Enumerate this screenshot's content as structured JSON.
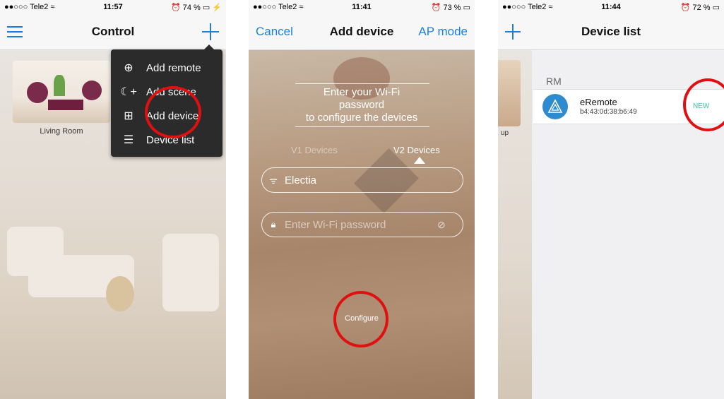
{
  "phone1": {
    "status": {
      "carrier": "●●○○○ Tele2 ≈",
      "time": "11:57",
      "battery": "⏰ 74 % ▭ ⚡"
    },
    "title": "Control",
    "menu_icon": "hamburger-icon",
    "plus_icon": "plus-icon",
    "room_caption": "Living Room",
    "menu": [
      {
        "icon": "remote-add-icon",
        "glyph": "⊕",
        "label": "Add remote"
      },
      {
        "icon": "scene-add-icon",
        "glyph": "☾+",
        "label": "Add scene"
      },
      {
        "icon": "device-add-icon",
        "glyph": "⊞",
        "label": "Add device"
      },
      {
        "icon": "list-icon",
        "glyph": "☰",
        "label": "Device list"
      }
    ]
  },
  "phone2": {
    "status": {
      "carrier": "●●○○○ Tele2 ≈",
      "time": "11:41",
      "battery": "⏰ 73 % ▭"
    },
    "cancel": "Cancel",
    "title": "Add device",
    "ap_mode": "AP mode",
    "prompt": [
      "Enter your Wi-Fi",
      "password",
      "to configure the devices"
    ],
    "tab_v1": "V1 Devices",
    "tab_v2": "V2 Devices",
    "ssid": "Electia",
    "password_placeholder": "Enter Wi-Fi password",
    "configure": "Configure"
  },
  "phone3": {
    "status": {
      "carrier": "●●○○○ Tele2 ≈",
      "time": "11:44",
      "battery": "⏰ 72 % ▭"
    },
    "title": "Device list",
    "partial_text": "up",
    "section": "RM",
    "device": {
      "name": "eRemote",
      "mac": "b4:43:0d:38:b6:49",
      "badge": "NEW"
    }
  },
  "colors": {
    "accent": "#1a7fe0",
    "highlight": "#e01010",
    "badge": "#37c2a3"
  }
}
